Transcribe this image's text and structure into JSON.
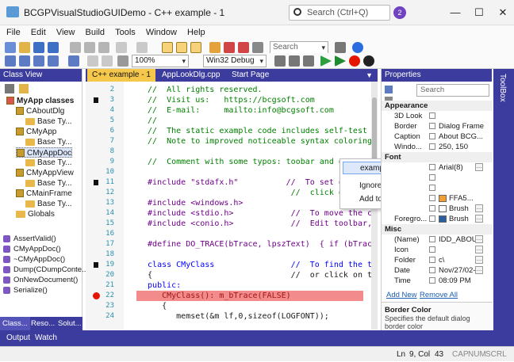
{
  "window": {
    "title": "BCGPVisualStudioGUIDemo - C++ example - 1",
    "search_placeholder": "Search (Ctrl+Q)",
    "notification_count": "2",
    "min": "—",
    "max": "☐",
    "close": "✕"
  },
  "menu": [
    "File",
    "Edit",
    "View",
    "Build",
    "Tools",
    "Window",
    "Help"
  ],
  "toolbar": {
    "search_placeholder": "Search",
    "zoom": "100%",
    "config": "Win32 Debug"
  },
  "class_view": {
    "title": "Class View",
    "tree": [
      {
        "label": "MyApp classes",
        "indent": 0,
        "bold": true,
        "icon": "root"
      },
      {
        "label": "CAboutDlg",
        "indent": 1,
        "icon": "class"
      },
      {
        "label": "Base Ty...",
        "indent": 2,
        "icon": "folder"
      },
      {
        "label": "CMyApp",
        "indent": 1,
        "icon": "class"
      },
      {
        "label": "Base Ty...",
        "indent": 2,
        "icon": "folder"
      },
      {
        "label": "CMyAppDoc",
        "indent": 1,
        "icon": "class",
        "selected": true
      },
      {
        "label": "Base Ty...",
        "indent": 2,
        "icon": "folder"
      },
      {
        "label": "CMyAppView",
        "indent": 1,
        "icon": "class"
      },
      {
        "label": "Base Ty...",
        "indent": 2,
        "icon": "folder"
      },
      {
        "label": "CMainFrame",
        "indent": 1,
        "icon": "class"
      },
      {
        "label": "Base Ty...",
        "indent": 2,
        "icon": "folder"
      },
      {
        "label": "Globals",
        "indent": 1,
        "icon": "folder"
      }
    ],
    "members": [
      "AssertValid()",
      "CMyAppDoc()",
      "~CMyAppDoc()",
      "Dump(CDumpConte...",
      "OnNewDocument()",
      "Serialize()"
    ],
    "tabs": [
      "Class...",
      "Reso...",
      "Solut..."
    ]
  },
  "editor": {
    "tabs": [
      "C++ example - 1",
      "AppLookDlg.cpp",
      "Start Page"
    ],
    "lines": [
      {
        "n": "2",
        "t": "  //  All rights reserved.",
        "cls": "c"
      },
      {
        "n": "3",
        "t": "  //  Visit us:   https://bcgsoft.com",
        "cls": "c"
      },
      {
        "n": "4",
        "t": "  //  E-mail:     mailto:info@bcgsoft.com",
        "cls": "c"
      },
      {
        "n": "5",
        "t": "  //",
        "cls": "c"
      },
      {
        "n": "6",
        "t": "  //  The static example code includes self-test",
        "cls": "c"
      },
      {
        "n": "7",
        "t": "  //  Note to improved noticeable syntax coloring",
        "cls": "c"
      },
      {
        "n": "8",
        "t": "",
        "cls": ""
      },
      {
        "n": "9",
        "t": "  //  Comment with some typos: toobar and exa",
        "cls": "c"
      },
      {
        "n": "10",
        "t": "",
        "cls": ""
      },
      {
        "n": "11",
        "t": "  #include \"stdafx.h\"          //  To set or",
        "cls": "p"
      },
      {
        "n": "12",
        "t": "                                //  click on t",
        "cls": "c"
      },
      {
        "n": "13",
        "t": "  #include <windows.h>",
        "cls": "p"
      },
      {
        "n": "14",
        "t": "  #include <stdio.h>            //  To move the cur",
        "cls": "p"
      },
      {
        "n": "15",
        "t": "  #include <conio.h>            //  Edit toolbar, N",
        "cls": "p"
      },
      {
        "n": "16",
        "t": "",
        "cls": ""
      },
      {
        "n": "17",
        "t": "  #define DO_TRACE(bTrace, lpszText)  { if (bTrac",
        "cls": "p"
      },
      {
        "n": "18",
        "t": "",
        "cls": ""
      },
      {
        "n": "19",
        "t": "  class CMyClass                //  To find the tex",
        "cls": "k"
      },
      {
        "n": "20",
        "t": "  {                             //  or click on the",
        "cls": ""
      },
      {
        "n": "21",
        "t": "  public:",
        "cls": "k"
      },
      {
        "n": "22",
        "t": "     CMyClass(): m_bTrace(FALSE)",
        "cls": "s"
      },
      {
        "n": "23",
        "t": "     {",
        "cls": ""
      },
      {
        "n": "24",
        "t": "        memset(&m lf,0,sizeof(LOGFONT));",
        "cls": ""
      }
    ]
  },
  "context_menu": [
    "example",
    "Ignore All",
    "Add to Dictionary"
  ],
  "properties": {
    "title": "Properties",
    "search_placeholder": "Search",
    "rows": [
      {
        "type": "cat",
        "name": "Appearance"
      },
      {
        "name": "3D Look",
        "val": "",
        "check": true
      },
      {
        "name": "Border",
        "val": "Dialog Frame"
      },
      {
        "name": "Caption",
        "val": "About BCG..."
      },
      {
        "name": "Windo...",
        "val": "250, 150"
      },
      {
        "type": "cat",
        "name": "Font"
      },
      {
        "name": "",
        "val": "Arial(8)"
      },
      {
        "name": "",
        "val": ""
      },
      {
        "name": "",
        "val": ""
      },
      {
        "name": "",
        "val": "FFA5..."
      },
      {
        "name": "",
        "val": "Brush"
      },
      {
        "name": "Foregro...",
        "val": "Brush"
      },
      {
        "type": "cat",
        "name": "Misc"
      },
      {
        "name": "(Name)",
        "val": "IDD_ABOU..."
      },
      {
        "name": "Icon",
        "val": ""
      },
      {
        "name": "Folder",
        "val": "c\\"
      },
      {
        "name": "Date",
        "val": "Nov/27/02-"
      },
      {
        "name": "Time",
        "val": "08:09 PM"
      }
    ],
    "add_new": "Add New",
    "remove_all": "Remove All",
    "desc_title": "Border Color",
    "desc_text": "Specifies the default dialog border color"
  },
  "toolbox_label": "ToolBox",
  "bottom_tabs": [
    "Output",
    "Watch"
  ],
  "status": {
    "ln": "Ln",
    "ln_val": "9, Col",
    "col": "43",
    "caps": "CAP",
    "num": "NUM",
    "scrl": "SCRL"
  },
  "colors": {
    "accent": "#3c3c9e",
    "tab_active": "#f5c84c",
    "breakpoint": "#e51400"
  }
}
